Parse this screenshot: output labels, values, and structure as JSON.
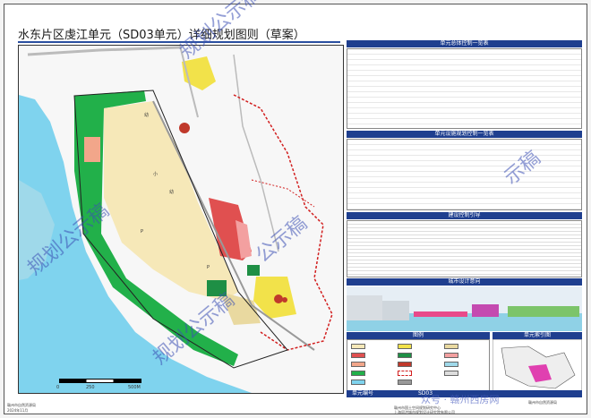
{
  "header": {
    "title": "水东片区虔江单元（SD03单元）详细规划图则（草案）"
  },
  "panel": {
    "section_unit_control": "单元总体控制一览表",
    "section_parcel_control": "单元设施规划控制一览表",
    "section_guidance": "建设控制引导",
    "section_urban_design": "城市设计意向",
    "section_legend": "图例",
    "section_unit_index": "单元索引图",
    "unit_no_label": "单元编号",
    "unit_no_value": "SD03"
  },
  "map": {
    "scale_labels": [
      "0",
      "250",
      "500M"
    ],
    "symbol_labels": [
      "幼",
      "小",
      "幼",
      "P",
      "P"
    ]
  },
  "watermarks": [
    "规划公示稿",
    "规划公示稿",
    "公示稿",
    "示稿",
    "规划公示稿"
  ],
  "footer": {
    "left_org": "赣州市自然资源局",
    "left_date": "2024年11月",
    "right_org": "赣州市自然资源局",
    "right_org2": "赣州市国土空间规划研究中心",
    "right_org3": "上海同济城市规划设计研究院有限公司"
  },
  "watermark_source": "众号 · 赣州西房网",
  "colors": {
    "river": "#7fd3ee",
    "green": "#22b04a",
    "residential": "#f6e8b8",
    "commercial": "#e05050",
    "school": "#f2a68a",
    "yellow": "#f2e24a",
    "header_blue": "#1f3f8f"
  }
}
